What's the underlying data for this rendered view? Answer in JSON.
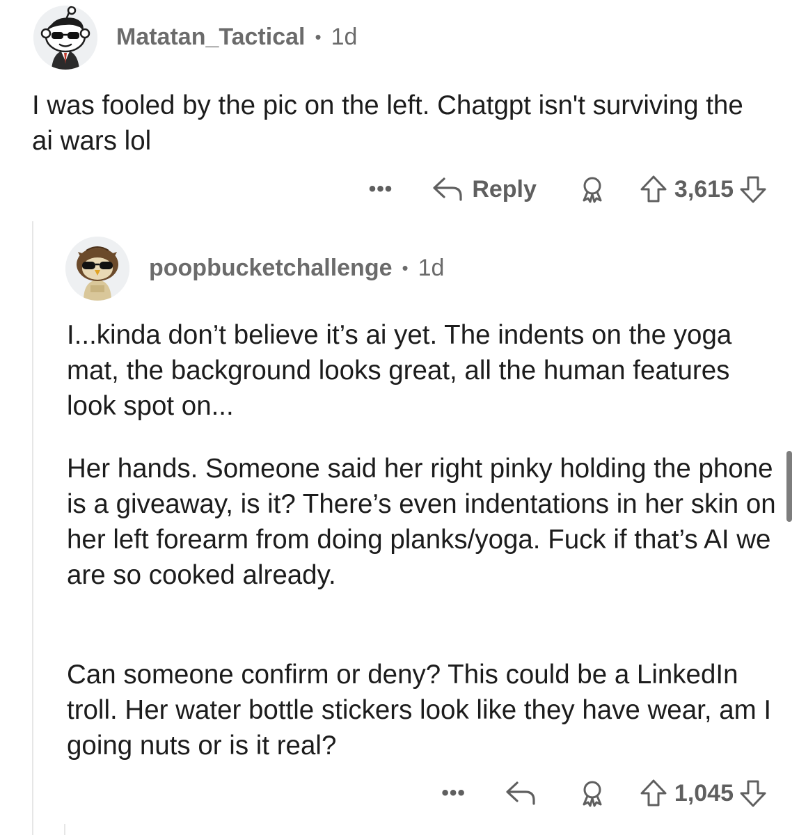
{
  "comment1": {
    "username": "Matatan_Tactical",
    "separator": "•",
    "time": "1d",
    "body": "I was fooled by the pic on the left. Chatgpt isn't surviving the ai wars lol",
    "more_label": "•••",
    "reply_label": "Reply",
    "score": "3,615",
    "avatar_icon": "snoo-sunglasses-suit-avatar"
  },
  "comment2": {
    "username": "poopbucketchallenge",
    "separator": "•",
    "time": "1d",
    "paragraphs": [
      "I...kinda don’t believe it’s ai yet. The indents on the yoga mat, the background looks great, all the human features look spot on...",
      "Her hands. Someone said her right pinky holding the phone is a giveaway, is it? There’s even indentations in her skin on her left forearm from doing planks/yoga. Fuck if that’s AI we are so cooked already.",
      "Can someone confirm or deny? This could be a LinkedIn troll. Her water bottle stickers look like they have wear, am I going nuts or is it real?"
    ],
    "more_label": "•••",
    "score": "1,045",
    "avatar_icon": "snoo-owl-hat-avatar"
  },
  "icons": {
    "reply": "reply-arrow-icon",
    "award": "award-icon",
    "upvote": "upvote-arrow-icon",
    "downvote": "downvote-arrow-icon"
  },
  "colors": {
    "text": "#1c1c1c",
    "meta": "#6b6b6b",
    "action": "#5f5f5f",
    "thread_line": "#e6e6e6"
  }
}
